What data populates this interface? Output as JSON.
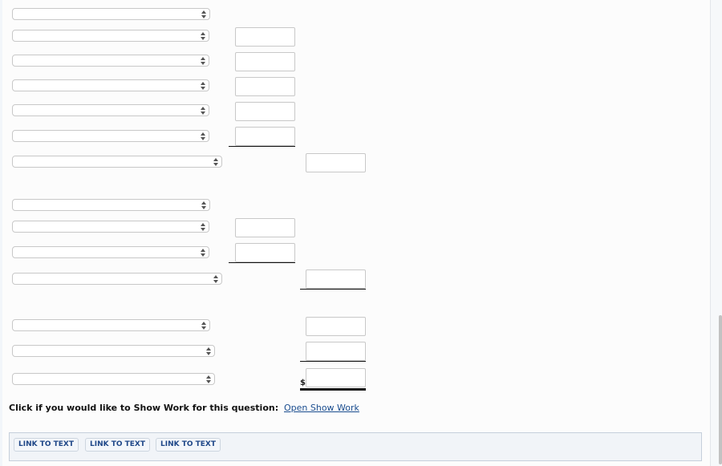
{
  "form": {
    "dropdowns": [
      {
        "id": "select-1",
        "value": ""
      },
      {
        "id": "select-2",
        "value": ""
      },
      {
        "id": "select-3",
        "value": ""
      },
      {
        "id": "select-4",
        "value": ""
      },
      {
        "id": "select-5",
        "value": ""
      },
      {
        "id": "select-6",
        "value": ""
      },
      {
        "id": "select-7",
        "value": ""
      },
      {
        "id": "select-8",
        "value": ""
      },
      {
        "id": "select-9",
        "value": ""
      },
      {
        "id": "select-10",
        "value": ""
      },
      {
        "id": "select-11",
        "value": ""
      },
      {
        "id": "select-12",
        "value": ""
      },
      {
        "id": "select-13",
        "value": ""
      },
      {
        "id": "select-14",
        "value": ""
      }
    ],
    "amount_inputs": [
      {
        "id": "amount-1",
        "value": ""
      },
      {
        "id": "amount-2",
        "value": ""
      },
      {
        "id": "amount-3",
        "value": ""
      },
      {
        "id": "amount-4",
        "value": ""
      },
      {
        "id": "amount-5",
        "value": ""
      },
      {
        "id": "total-1",
        "value": ""
      },
      {
        "id": "amount-6",
        "value": ""
      },
      {
        "id": "amount-7",
        "value": ""
      },
      {
        "id": "total-2",
        "value": ""
      },
      {
        "id": "total-3",
        "value": ""
      },
      {
        "id": "total-4",
        "value": ""
      },
      {
        "id": "final-total",
        "value": ""
      }
    ],
    "currency_symbol": "$"
  },
  "show_work": {
    "label": "Click if you would like to Show Work for this question:",
    "link": "Open Show Work"
  },
  "link_bar": {
    "buttons": [
      "LINK TO TEXT",
      "LINK TO TEXT",
      "LINK TO TEXT"
    ]
  }
}
